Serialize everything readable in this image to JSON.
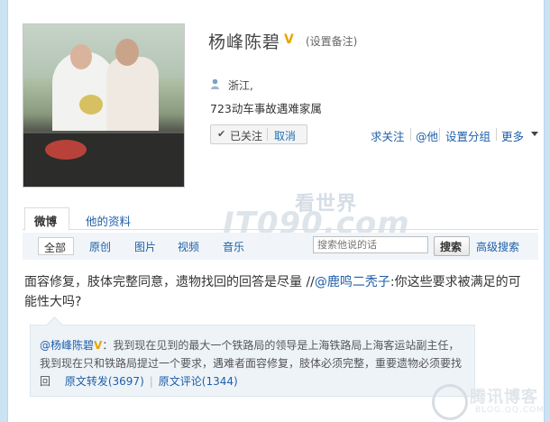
{
  "profile": {
    "name": "杨峰陈碧",
    "verified_badge": "V",
    "set_remark": "(设置备注)",
    "location": "浙江,",
    "bio": "723动车事故遇难家属",
    "followed_label": "已关注",
    "cancel_label": "取消"
  },
  "actions": {
    "ask_follow": "求关注",
    "at_him": "@他",
    "set_group": "设置分组",
    "more": "更多"
  },
  "watermark": {
    "top": "看世界",
    "main": "JT090.com"
  },
  "tabs": [
    {
      "label": "微博",
      "active": true
    },
    {
      "label": "他的资料",
      "active": false
    }
  ],
  "filters": {
    "items": [
      "全部",
      "原创",
      "图片",
      "视频",
      "音乐"
    ],
    "search_placeholder": "搜索他说的话",
    "search_button": "搜索",
    "advanced_search": "高级搜索"
  },
  "post": {
    "text": "面容修复，肢体完整同意，遗物找回的回答是尽量 //",
    "mention": "@鹿鸣二秃子",
    "text_after": ":你这些要求被满足的可能性大吗?"
  },
  "repost": {
    "author": "@杨峰陈碧",
    "badge": "V",
    "text": "：我到现在见到的最大一个铁路局的领导是上海铁路局上海客运站副主任，我到现在只和铁路局提过一个要求，遇难者面容修复，肢体必须完整，重要遗物必须要找回",
    "repost_count": "原文转发(3697)",
    "comment_count": "原文评论(1344)"
  },
  "corner_logo": {
    "text": "腾讯博客",
    "sub": "BLOG.QQ.COM"
  },
  "colors": {
    "link": "#1f5fa8",
    "verified": "#e8a400",
    "background": "#c9e3f2"
  }
}
